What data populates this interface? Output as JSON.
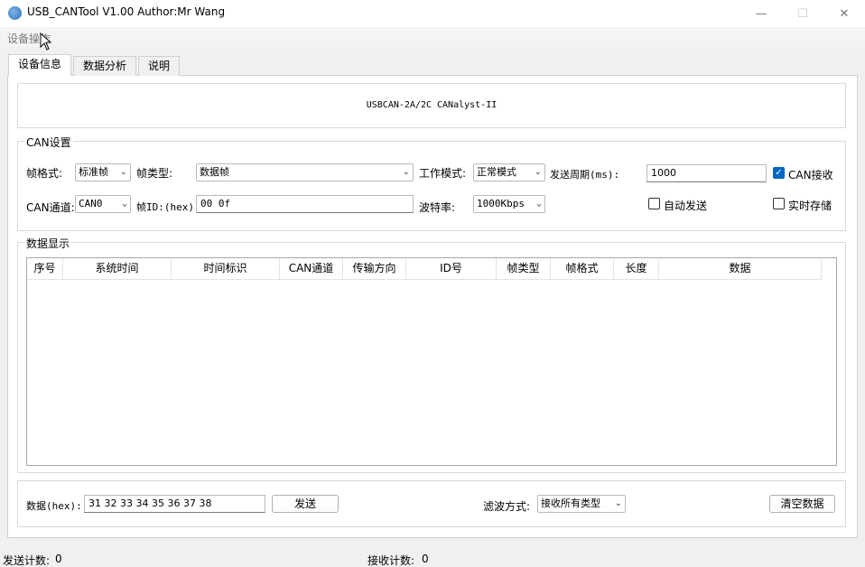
{
  "window": {
    "title": "USB_CANTool V1.00 Author:Mr Wang"
  },
  "menu": {
    "device_ops": "设备操作"
  },
  "tabs": [
    {
      "label": "设备信息"
    },
    {
      "label": "数据分析"
    },
    {
      "label": "说明"
    }
  ],
  "device": {
    "name": "USBCAN-2A/2C CANalyst-II"
  },
  "can_settings": {
    "title": "CAN设置",
    "frame_format_label": "帧格式:",
    "frame_format_value": "标准帧",
    "frame_type_label": "帧类型:",
    "frame_type_value": "数据帧",
    "work_mode_label": "工作模式:",
    "work_mode_value": "正常模式",
    "send_period_label": "发送周期(ms):",
    "send_period_value": "1000",
    "can_receive_label": "CAN接收",
    "channel_label": "CAN通道:",
    "channel_value": "CAN0",
    "frame_id_label": "帧ID:(hex)",
    "frame_id_value": "00 0f",
    "baud_label": "波特率:",
    "baud_value": "1000Kbps",
    "auto_send_label": "自动发送",
    "realtime_save_label": "实时存储"
  },
  "data_display": {
    "title": "数据显示",
    "columns": [
      "序号",
      "系统时间",
      "时间标识",
      "CAN通道",
      "传输方向",
      "ID号",
      "帧类型",
      "帧格式",
      "长度",
      "数据"
    ]
  },
  "send_bar": {
    "data_label": "数据(hex):",
    "data_value": "31 32 33 34 35 36 37 38",
    "send_button": "发送",
    "filter_label": "滤波方式:",
    "filter_value": "接收所有类型",
    "clear_button": "清空数据"
  },
  "status": {
    "sent_label": "发送计数:",
    "sent_count": "0",
    "recv_label": "接收计数:",
    "recv_count": "0"
  },
  "colors": {
    "accent": "#0067c0"
  }
}
